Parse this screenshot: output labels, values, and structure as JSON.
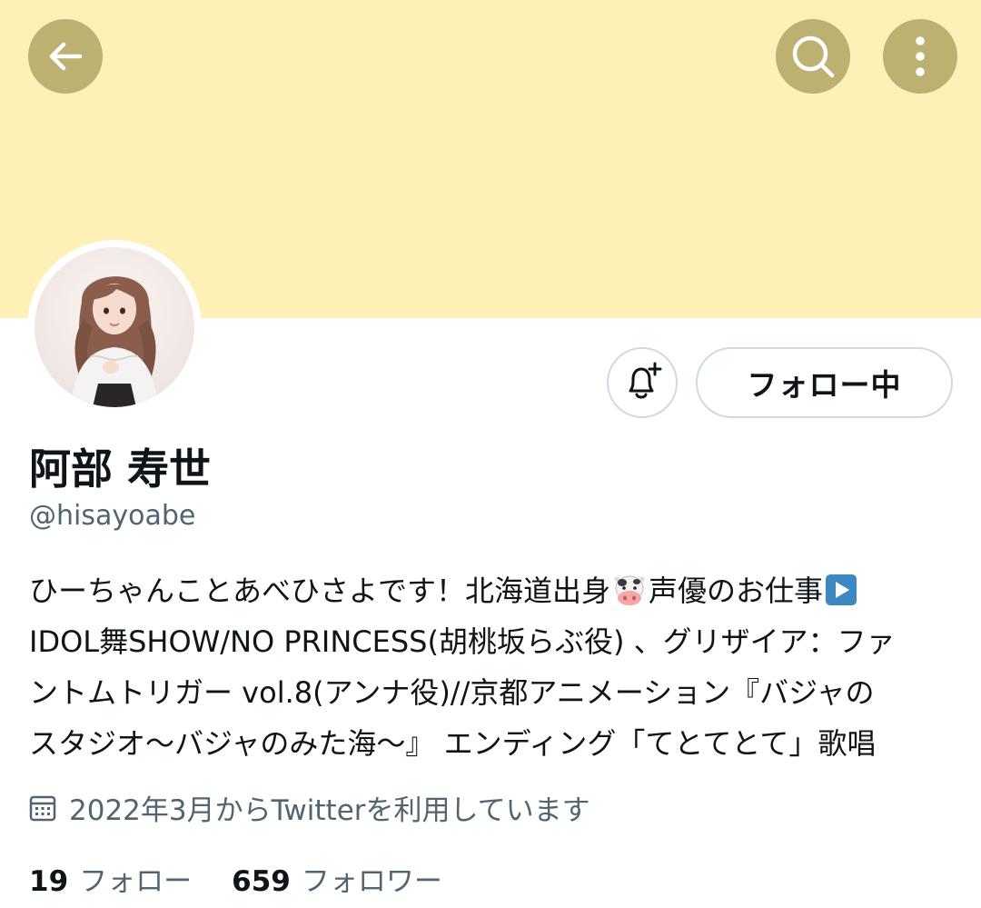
{
  "header": {
    "banner_color": "#fdf1b8",
    "button_color": "#bcb170",
    "back_icon": "arrow-left-icon",
    "search_icon": "search-icon",
    "more_icon": "more-vertical-icon"
  },
  "profile": {
    "display_name": "阿部 寿世",
    "handle": "@hisayoabe",
    "notify_icon": "bell-plus-icon",
    "follow_button_label": "フォロー中",
    "bio_lines": [
      {
        "text": "ひーちゃんことあべひさよです！北海道出身",
        "emoji": "cow-face",
        "after": "声優のお仕事",
        "emoji2": "play-button"
      },
      {
        "text": "IDOL舞SHOW/NO PRINCESS(胡桃坂らぶ役) 、グリザイア：ファ"
      },
      {
        "text": "ントムトリガー vol.8(アンナ役)//京都アニメーション『バジャの"
      },
      {
        "text": "スタジオ〜バジャのみた海〜』 エンディング「てとてとて」歌唱"
      }
    ],
    "joined_icon": "calendar-icon",
    "joined_text": "2022年3月からTwitterを利用しています",
    "following_count": "19",
    "following_label": "フォロー",
    "followers_count": "659",
    "followers_label": "フォロワー"
  }
}
